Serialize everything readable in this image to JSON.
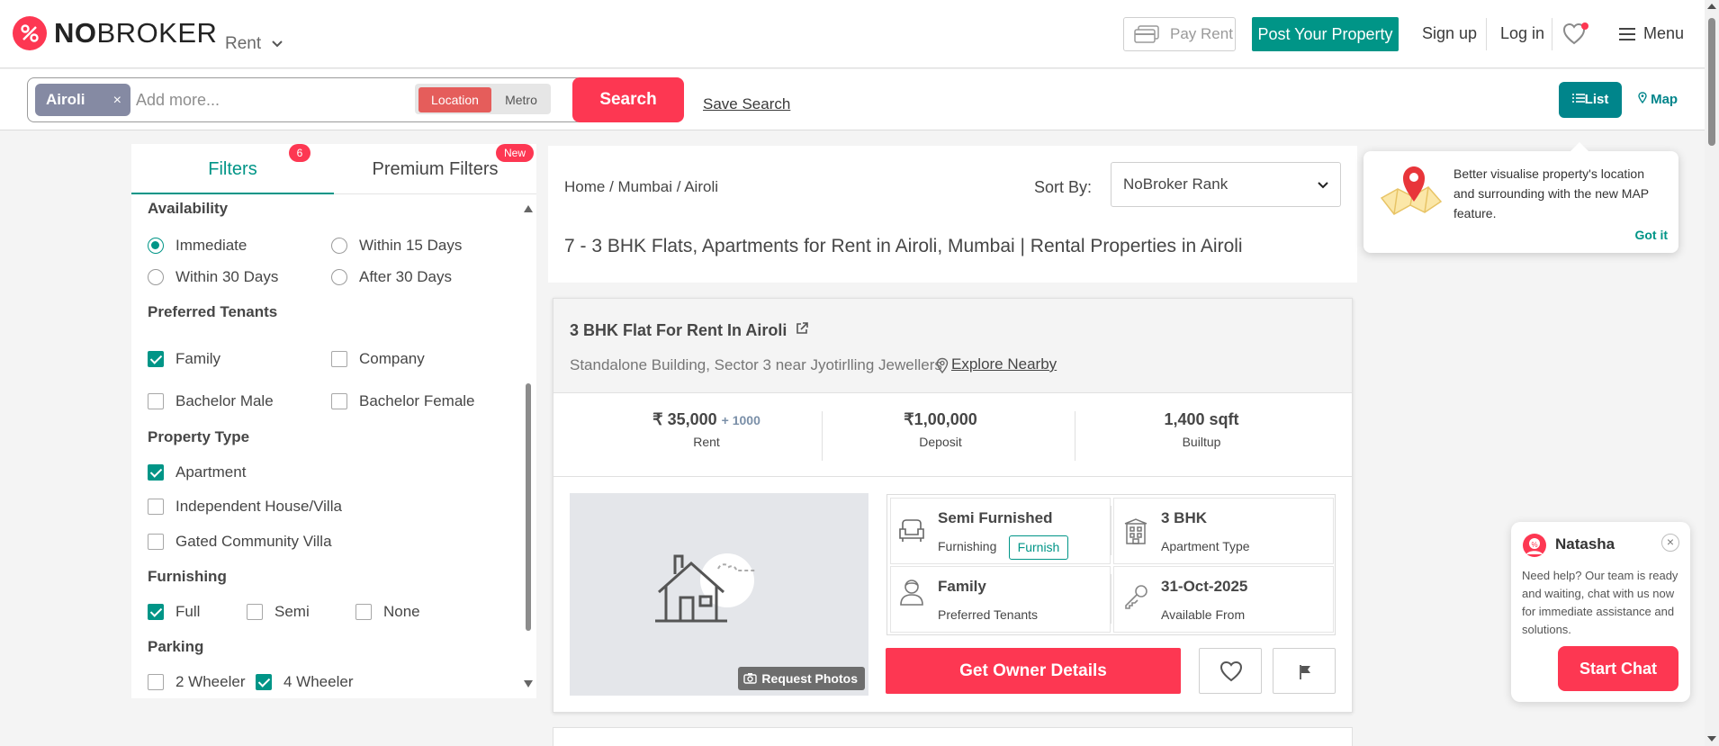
{
  "header": {
    "logo_bold": "NO",
    "logo_light": "BROKER",
    "rent_dropdown": "Rent",
    "pay_rent": "Pay Rent",
    "post_property": "Post Your Property",
    "sign_up": "Sign up",
    "log_in": "Log in",
    "menu": "Menu"
  },
  "search": {
    "chip": "Airoli",
    "chip_close": "×",
    "placeholder": "Add more...",
    "location_tab": "Location",
    "metro_tab": "Metro",
    "search_button": "Search",
    "save_search": "Save Search",
    "list_view": "List",
    "map_view": "Map"
  },
  "filters": {
    "tab_filters": "Filters",
    "filters_badge": "6",
    "tab_premium": "Premium Filters",
    "premium_badge": "New",
    "availability": {
      "title": "Availability",
      "options": [
        {
          "label": "Immediate",
          "checked": true
        },
        {
          "label": "Within 15 Days",
          "checked": false
        },
        {
          "label": "Within 30 Days",
          "checked": false
        },
        {
          "label": "After 30 Days",
          "checked": false
        }
      ]
    },
    "tenants": {
      "title": "Preferred Tenants",
      "options": [
        {
          "label": "Family",
          "checked": true
        },
        {
          "label": "Company",
          "checked": false
        },
        {
          "label": "Bachelor Male",
          "checked": false
        },
        {
          "label": "Bachelor Female",
          "checked": false
        }
      ]
    },
    "property_type": {
      "title": "Property Type",
      "options": [
        {
          "label": "Apartment",
          "checked": true
        },
        {
          "label": "Independent House/Villa",
          "checked": false
        },
        {
          "label": "Gated Community Villa",
          "checked": false
        }
      ]
    },
    "furnishing": {
      "title": "Furnishing",
      "options": [
        {
          "label": "Full",
          "checked": true
        },
        {
          "label": "Semi",
          "checked": false
        },
        {
          "label": "None",
          "checked": false
        }
      ]
    },
    "parking": {
      "title": "Parking",
      "options": [
        {
          "label": "2 Wheeler",
          "checked": false
        },
        {
          "label": "4 Wheeler",
          "checked": true
        }
      ]
    }
  },
  "results": {
    "breadcrumb": "Home  / Mumbai / Airoli",
    "sort_label": "Sort By:",
    "sort_value": "NoBroker Rank",
    "page_title": "7 - 3 BHK Flats, Apartments for Rent in Airoli, Mumbai | Rental Properties in Airoli"
  },
  "property": {
    "title": "3 BHK Flat For Rent In Airoli",
    "address": "Standalone Building, Sector 3 near Jyotirlling Jewellers",
    "explore": "Explore Nearby",
    "rent_value": "₹ 35,000",
    "rent_extra": "+ 1000",
    "rent_label": "Rent",
    "deposit_value": "₹1,00,000",
    "deposit_label": "Deposit",
    "builtup_value": "1,400 sqft",
    "builtup_label": "Builtup",
    "request_photos": "Request Photos",
    "furnishing_value": "Semi Furnished",
    "furnishing_label": "Furnishing",
    "furnish_tag": "Furnish",
    "apartment_value": "3 BHK",
    "apartment_label": "Apartment Type",
    "tenants_value": "Family",
    "tenants_label": "Preferred Tenants",
    "available_value": "31-Oct-2025",
    "available_label": "Available From",
    "owner_button": "Get Owner Details"
  },
  "map_tip": {
    "text": "Better visualise property's location and surrounding with the new MAP feature.",
    "got_it": "Got it"
  },
  "chat": {
    "name": "Natasha",
    "close": "×",
    "message": "Need help? Our team is ready and waiting, chat with us now for immediate assistance and solutions.",
    "start": "Start Chat"
  },
  "colors": {
    "brand_red": "#fd3752",
    "teal": "#009587"
  }
}
